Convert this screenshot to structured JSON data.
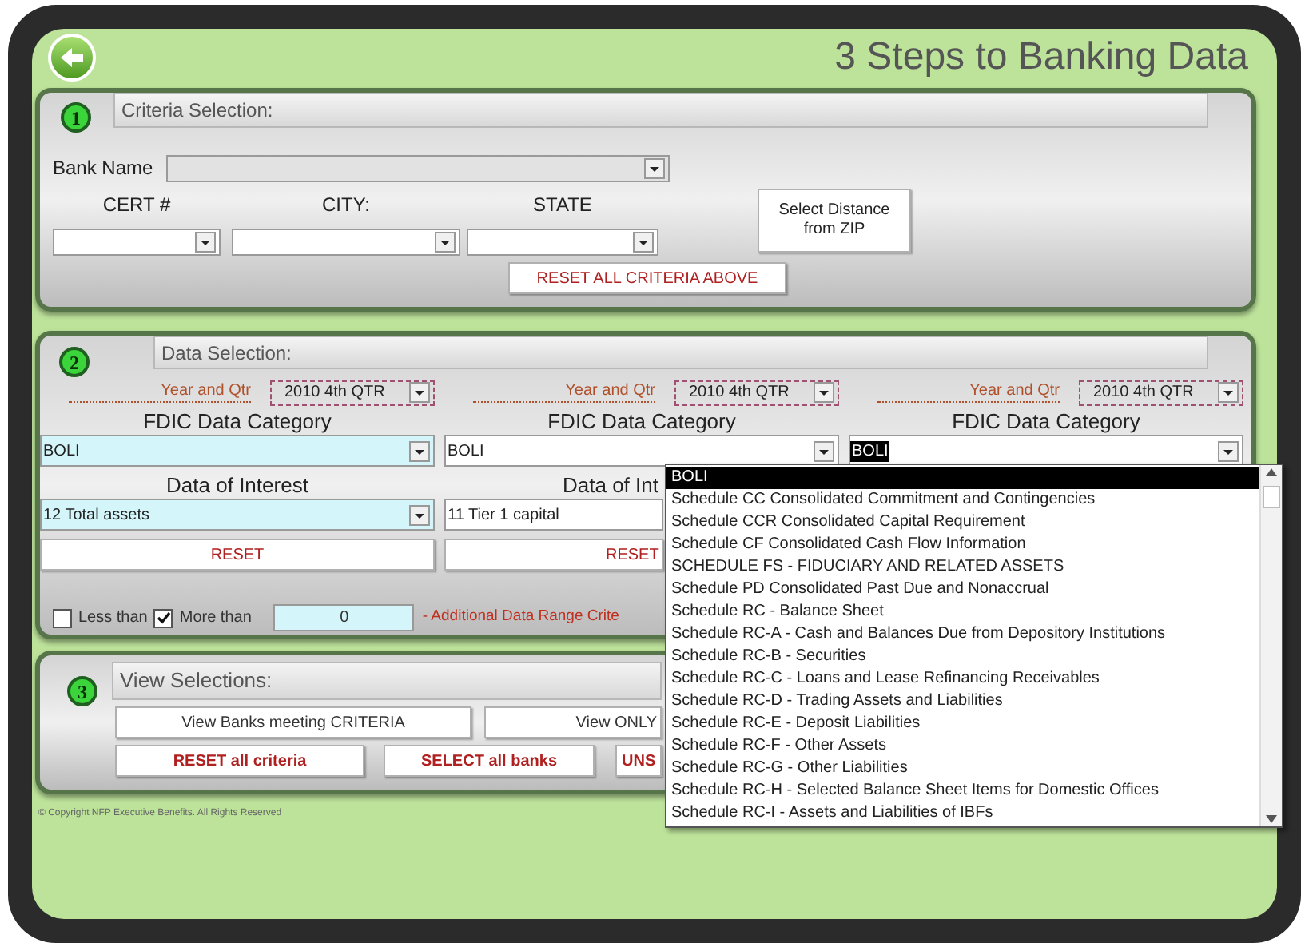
{
  "title": "3 Steps to Banking Data",
  "criteria": {
    "step": "1",
    "header": "Criteria Selection:",
    "bank_name_label": "Bank Name",
    "fields": [
      {
        "label": "CERT #"
      },
      {
        "label": "CITY:"
      },
      {
        "label": "STATE"
      }
    ],
    "distance_button": "Select Distance from ZIP",
    "reset_button": "RESET ALL CRITERIA ABOVE"
  },
  "data_selection": {
    "step": "2",
    "header": "Data Selection:",
    "columns": [
      {
        "year_label": "Year and Qtr",
        "year_value": "2010 4th QTR",
        "category_header": "FDIC Data Category",
        "category_value": "BOLI",
        "highlighted": true,
        "text_selected": false,
        "interest_header": "Data of Interest",
        "interest_value": "12 Total assets",
        "reset": "RESET"
      },
      {
        "year_label": "Year and Qtr",
        "year_value": "2010 4th QTR",
        "category_header": "FDIC Data Category",
        "category_value": "BOLI",
        "highlighted": false,
        "text_selected": false,
        "interest_header": "Data of Int",
        "interest_value": "11 Tier 1 capital",
        "reset": "RESET"
      },
      {
        "year_label": "Year and Qtr",
        "year_value": "2010 4th QTR",
        "category_header": "FDIC Data Category",
        "category_value": "BOLI",
        "highlighted": false,
        "text_selected": true
      }
    ],
    "range": {
      "options": [
        {
          "label": "Less than",
          "checked": false
        },
        {
          "label": "More than",
          "checked": true
        }
      ],
      "value": "0",
      "note": "- Additional Data Range Crite"
    }
  },
  "view": {
    "step": "3",
    "header": "View Selections:",
    "view_buttons": [
      {
        "label": "View Banks meeting CRITERIA",
        "kind": "plain"
      },
      {
        "label": "View ONLY",
        "kind": "plain"
      }
    ],
    "action_buttons": [
      {
        "label": "RESET all criteria",
        "kind": "action"
      },
      {
        "label": "SELECT all banks",
        "kind": "action"
      },
      {
        "label": "UNS",
        "kind": "action"
      }
    ]
  },
  "copyright": "© Copyright NFP Executive Benefits.  All Rights Reserved",
  "dropdown": {
    "items": [
      {
        "label": "BOLI",
        "selected": true
      },
      {
        "label": "Schedule CC  Consolidated Commitment and Contingencies",
        "selected": false
      },
      {
        "label": "Schedule CCR    Consolidated Capital Requirement",
        "selected": false
      },
      {
        "label": "Schedule CF    Consolidated Cash Flow Information",
        "selected": false
      },
      {
        "label": "SCHEDULE FS - FIDUCIARY AND RELATED ASSETS",
        "selected": false
      },
      {
        "label": "Schedule PD Consolidated Past Due and Nonaccrual",
        "selected": false
      },
      {
        "label": "Schedule RC - Balance Sheet",
        "selected": false
      },
      {
        "label": "Schedule RC-A - Cash and Balances Due from Depository Institutions",
        "selected": false
      },
      {
        "label": "Schedule RC-B - Securities",
        "selected": false
      },
      {
        "label": "Schedule RC-C - Loans and Lease Refinancing Receivables",
        "selected": false
      },
      {
        "label": "Schedule RC-D - Trading Assets and Liabilities",
        "selected": false
      },
      {
        "label": "Schedule RC-E - Deposit Liabilities",
        "selected": false
      },
      {
        "label": "Schedule RC-F - Other Assets",
        "selected": false
      },
      {
        "label": "Schedule RC-G - Other Liabilities",
        "selected": false
      },
      {
        "label": "Schedule RC-H - Selected Balance Sheet Items for Domestic Offices",
        "selected": false
      },
      {
        "label": "Schedule RC-I - Assets and Liabilities of IBFs",
        "selected": false
      }
    ]
  }
}
